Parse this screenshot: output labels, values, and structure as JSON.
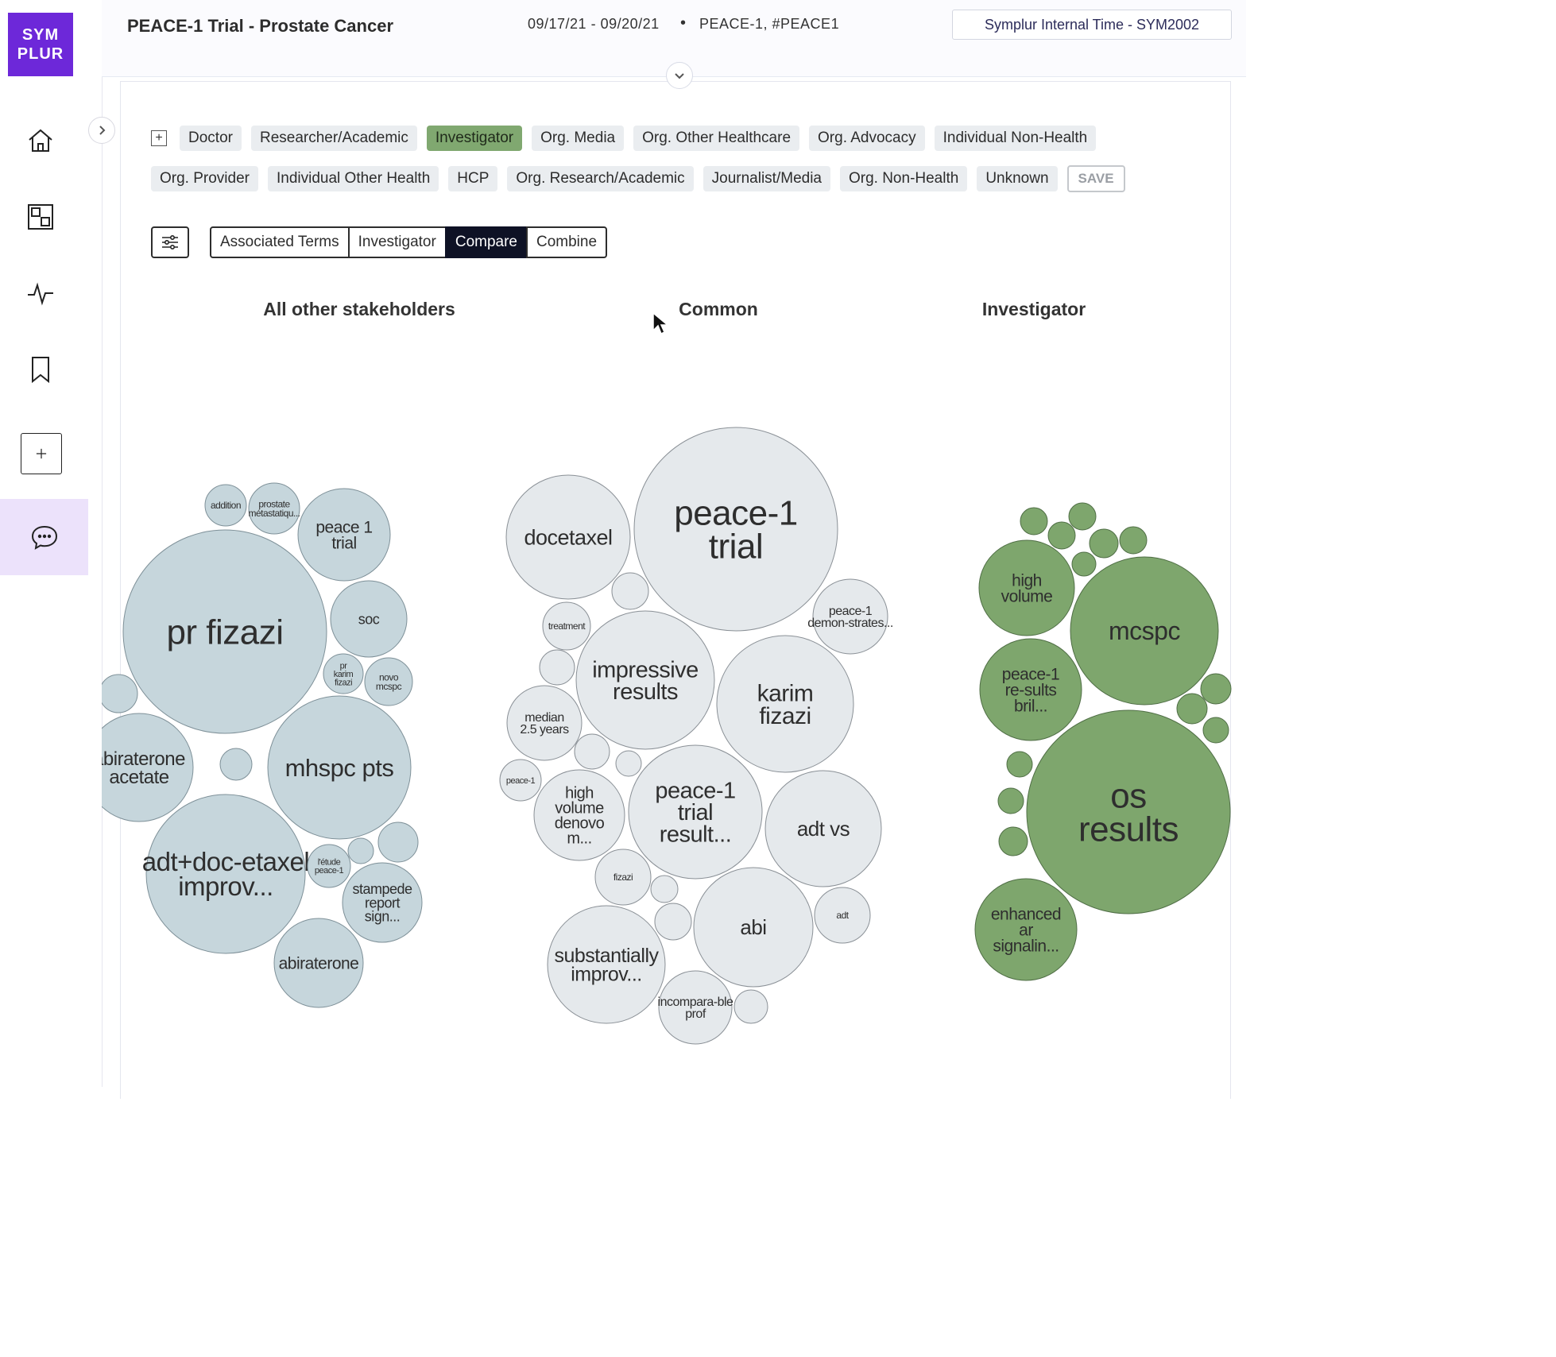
{
  "brand": {
    "line1": "SYM",
    "line2": "PLUR"
  },
  "header": {
    "title": "PEACE-1 Trial - Prostate Cancer",
    "dates": "09/17/21 - 09/20/21",
    "separator": "•",
    "tags": "PEACE-1, #PEACE1",
    "time_button": "Symplur Internal Time - SYM2002"
  },
  "sidebar": {
    "icons": [
      "home-icon",
      "dashboard-icon",
      "activity-icon",
      "bookmark-icon",
      "add-icon",
      "chat-icon"
    ]
  },
  "filters": {
    "plus": "+",
    "row1": [
      "Doctor",
      "Researcher/Academic",
      "Investigator",
      "Org. Media",
      "Org. Other Healthcare",
      "Org. Advocacy",
      "Individual Non-Health"
    ],
    "row2": [
      "Org. Provider",
      "Individual Other Health",
      "HCP",
      "Org. Research/Academic",
      "Journalist/Media",
      "Org. Non-Health",
      "Unknown"
    ],
    "active": "Investigator",
    "save_label": "SAVE"
  },
  "toolbar": {
    "segments": [
      "Associated Terms",
      "Investigator",
      "Compare",
      "Combine"
    ],
    "active": "Compare"
  },
  "columns": {
    "left": "All other stakeholders",
    "center": "Common",
    "right": "Investigator"
  },
  "colors": {
    "accent": "#6d28d9",
    "active_chip": "#80a870",
    "left_bubbles": "#c6d6dc",
    "common_bubbles": "#e5e9ec",
    "investigator_bubbles": "#7ea66d"
  },
  "bubbles": {
    "left": [
      {
        "label": "pr fizazi",
        "size": "xl"
      },
      {
        "label": "peace 1 trial",
        "size": "m"
      },
      {
        "label": "addition",
        "size": "xs"
      },
      {
        "label": "prostate métastatiqu...",
        "size": "xs"
      },
      {
        "label": "soc",
        "size": "m"
      },
      {
        "label": "pr karim fizazi",
        "size": "xs"
      },
      {
        "label": "novo mcspc",
        "size": "xs"
      },
      {
        "label": "abiraterone acetate",
        "size": "m"
      },
      {
        "label": "mhspc pts",
        "size": "l"
      },
      {
        "label": "adt+doc-etaxel improv...",
        "size": "l"
      },
      {
        "label": "l'étude peace-1",
        "size": "xs"
      },
      {
        "label": "stampede report sign...",
        "size": "s"
      },
      {
        "label": "abiraterone",
        "size": "m"
      }
    ],
    "common": [
      {
        "label": "peace-1 trial",
        "size": "xl"
      },
      {
        "label": "docetaxel",
        "size": "l"
      },
      {
        "label": "peace-1 demon-strates...",
        "size": "s"
      },
      {
        "label": "treatment",
        "size": "xs"
      },
      {
        "label": "impressive results",
        "size": "l"
      },
      {
        "label": "karim fizazi",
        "size": "l"
      },
      {
        "label": "median 2.5 years",
        "size": "s"
      },
      {
        "label": "peace-1",
        "size": "xs"
      },
      {
        "label": "high volume denovo m...",
        "size": "m"
      },
      {
        "label": "peace-1 trial result...",
        "size": "l"
      },
      {
        "label": "adt vs",
        "size": "l"
      },
      {
        "label": "fizazi",
        "size": "xs"
      },
      {
        "label": "abi",
        "size": "l"
      },
      {
        "label": "adt",
        "size": "xs"
      },
      {
        "label": "substantially improv...",
        "size": "l"
      },
      {
        "label": "incompara-ble prof",
        "size": "s"
      }
    ],
    "investigator": [
      {
        "label": "high volume",
        "size": "m"
      },
      {
        "label": "mcspc",
        "size": "l"
      },
      {
        "label": "peace-1 re-sults bril...",
        "size": "m"
      },
      {
        "label": "os results",
        "size": "xl"
      },
      {
        "label": "enhanced ar signalin...",
        "size": "m"
      }
    ]
  }
}
